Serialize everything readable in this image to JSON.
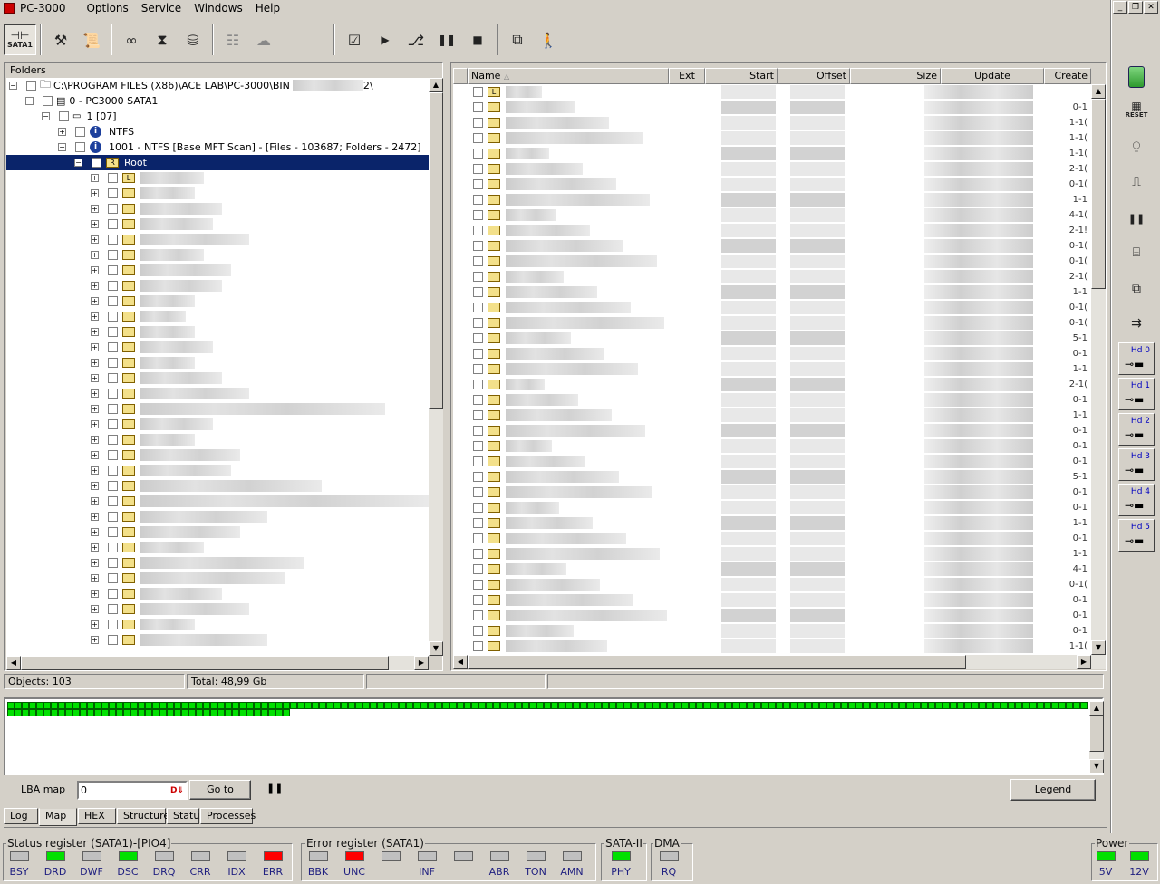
{
  "menu": {
    "app": "PC-3000",
    "items": [
      "Options",
      "Service",
      "Windows",
      "Help"
    ]
  },
  "toolbar": {
    "sata_label": "SATA1"
  },
  "tree": {
    "header": "Folders",
    "path": "C:\\PROGRAM FILES (X86)\\ACE LAB\\PC-3000\\BIN",
    "path_suffix": "2\\",
    "device": "0 - PC3000 SATA1",
    "partition": "1 [07]",
    "fs": "NTFS",
    "scan": "1001 - NTFS [Base MFT Scan] - [Files - 103687; Folders - 2472]",
    "root": "Root"
  },
  "list": {
    "columns": [
      "Name",
      "Ext",
      "Start",
      "Offset",
      "Size",
      "Update",
      "Create"
    ],
    "create_frag": [
      "0-1",
      "1-1(",
      "1-1(",
      "1-1(",
      "2-1(",
      "0-1(",
      "1-1",
      "4-1(",
      "2-1!",
      "0-1(",
      "0-1(",
      "2-1(",
      "1-1",
      "0-1(",
      "0-1(",
      "5-1",
      "0-1",
      "1-1",
      "2-1(",
      "0-1",
      "1-1",
      "0-1",
      "0-1",
      "0-1",
      "5-1",
      "0-1",
      "0-1",
      "1-1",
      "0-1",
      "1-1",
      "4-1",
      "0-1(",
      "0-1",
      "0-1"
    ]
  },
  "status": {
    "objects": "Objects: 103",
    "total": "Total: 48,99 Gb"
  },
  "map": {
    "lba_label": "LBA map",
    "lba_value": "0",
    "goto": "Go to",
    "legend": "Legend"
  },
  "tabs": [
    "Log",
    "Map",
    "HEX",
    "Structure",
    "Status",
    "Processes"
  ],
  "registers": {
    "status_title": "Status register (SATA1)-[PIO4]",
    "status_bits": [
      {
        "n": "BSY",
        "c": "#c0c0c0"
      },
      {
        "n": "DRD",
        "c": "#00e000"
      },
      {
        "n": "DWF",
        "c": "#c0c0c0"
      },
      {
        "n": "DSC",
        "c": "#00e000"
      },
      {
        "n": "DRQ",
        "c": "#c0c0c0"
      },
      {
        "n": "CRR",
        "c": "#c0c0c0"
      },
      {
        "n": "IDX",
        "c": "#c0c0c0"
      },
      {
        "n": "ERR",
        "c": "#ff0000"
      }
    ],
    "error_title": "Error register (SATA1)",
    "error_bits": [
      {
        "n": "BBK",
        "c": "#c0c0c0"
      },
      {
        "n": "UNC",
        "c": "#ff0000"
      },
      {
        "n": "",
        "c": "#c0c0c0"
      },
      {
        "n": "INF",
        "c": "#c0c0c0"
      },
      {
        "n": "",
        "c": "#c0c0c0"
      },
      {
        "n": "ABR",
        "c": "#c0c0c0"
      },
      {
        "n": "TON",
        "c": "#c0c0c0"
      },
      {
        "n": "AMN",
        "c": "#c0c0c0"
      }
    ],
    "sata_title": "SATA-II",
    "sata_bits": [
      {
        "n": "PHY",
        "c": "#00e000"
      }
    ],
    "dma_title": "DMA",
    "dma_bits": [
      {
        "n": "RQ",
        "c": "#c0c0c0"
      }
    ],
    "power_title": "Power",
    "power_bits": [
      {
        "n": "5V",
        "c": "#00e000"
      },
      {
        "n": "12V",
        "c": "#00e000"
      }
    ]
  },
  "right_toolbar": {
    "reset": "RESET",
    "hd": [
      "Hd 0",
      "Hd 1",
      "Hd 2",
      "Hd 3",
      "Hd 4",
      "Hd 5"
    ]
  }
}
